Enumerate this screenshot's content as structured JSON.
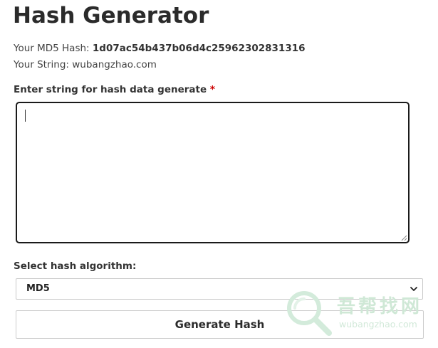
{
  "page": {
    "title": "Hash Generator"
  },
  "result": {
    "hash_label": "Your MD5 Hash:",
    "hash_value": "1d07ac54b437b06d4c25962302831316",
    "string_label": "Your String:",
    "string_value": "wubangzhao.com"
  },
  "form": {
    "input_label": "Enter string for hash data generate",
    "required_mark": "*",
    "input_value": "",
    "algorithm_label": "Select hash algorithm:",
    "algorithm_selected": "MD5",
    "submit_label": "Generate Hash"
  },
  "watermark": {
    "text_cn": "吾帮找网",
    "text_en": "wubangzhao.com"
  },
  "colors": {
    "required": "#cc0000",
    "textarea_border": "#1a1a1a",
    "watermark": "#cfe8d6"
  }
}
